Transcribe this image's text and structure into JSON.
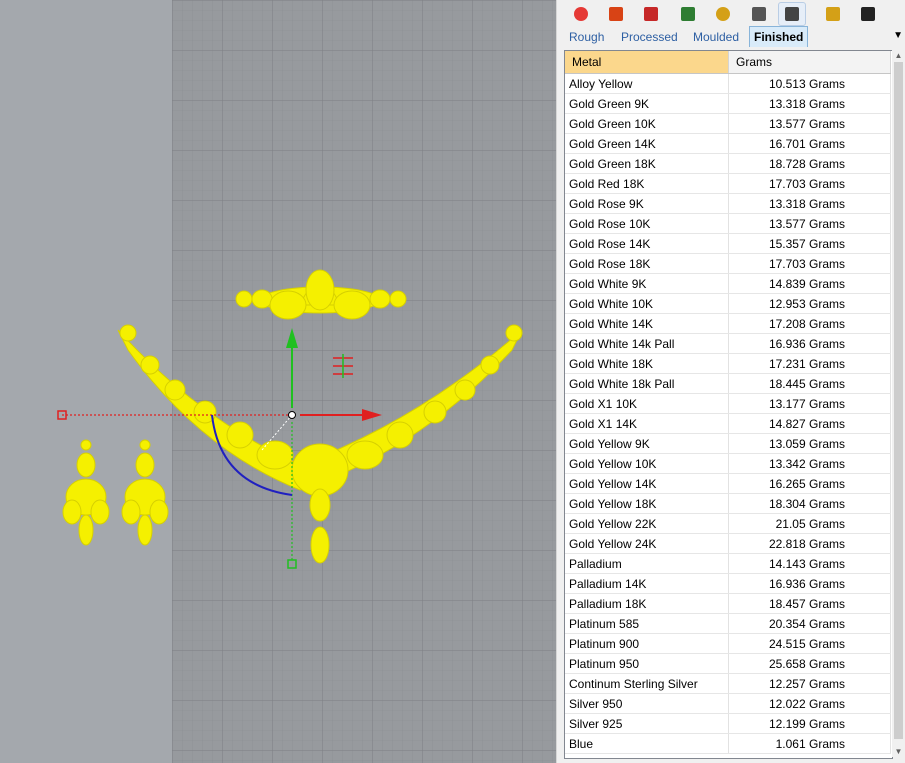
{
  "toolbar": {
    "icons": [
      {
        "name": "color-wheel-icon",
        "color": "#e53935",
        "active": false
      },
      {
        "name": "paint-bucket-icon",
        "color": "#d84315",
        "active": false
      },
      {
        "name": "brush-icon",
        "color": "#c62828",
        "active": false
      },
      {
        "name": "rg-logo-icon",
        "color": "#2e7d32",
        "active": false
      },
      {
        "name": "gold-sphere-icon",
        "color": "#d4a017",
        "active": false
      },
      {
        "name": "stopwatch-icon",
        "color": "#555555",
        "active": false
      },
      {
        "name": "weight-scale-icon",
        "color": "#444444",
        "active": true
      },
      {
        "name": "gold-bars-icon",
        "color": "#d4a017",
        "active": false
      },
      {
        "name": "monitor-icon",
        "color": "#222222",
        "active": false
      }
    ]
  },
  "tabs": [
    {
      "label": "Rough",
      "active": false
    },
    {
      "label": "Processed",
      "active": false
    },
    {
      "label": "Moulded",
      "active": false
    },
    {
      "label": "Finished",
      "active": true
    }
  ],
  "table": {
    "headers": {
      "metal": "Metal",
      "grams": "Grams"
    },
    "rows": [
      {
        "metal": "Alloy Yellow",
        "grams": "10.513 Grams"
      },
      {
        "metal": "Gold Green 9K",
        "grams": "13.318 Grams"
      },
      {
        "metal": "Gold Green 10K",
        "grams": "13.577 Grams"
      },
      {
        "metal": "Gold Green 14K",
        "grams": "16.701 Grams"
      },
      {
        "metal": "Gold Green 18K",
        "grams": "18.728 Grams"
      },
      {
        "metal": "Gold Red 18K",
        "grams": "17.703 Grams"
      },
      {
        "metal": "Gold Rose 9K",
        "grams": "13.318 Grams"
      },
      {
        "metal": "Gold Rose 10K",
        "grams": "13.577 Grams"
      },
      {
        "metal": "Gold Rose 14K",
        "grams": "15.357 Grams"
      },
      {
        "metal": "Gold Rose 18K",
        "grams": "17.703 Grams"
      },
      {
        "metal": "Gold White 9K",
        "grams": "14.839 Grams"
      },
      {
        "metal": "Gold White 10K",
        "grams": "12.953 Grams"
      },
      {
        "metal": "Gold White 14K",
        "grams": "17.208 Grams"
      },
      {
        "metal": "Gold White 14k Pall",
        "grams": "16.936 Grams"
      },
      {
        "metal": "Gold White 18K",
        "grams": "17.231 Grams"
      },
      {
        "metal": "Gold White 18k Pall",
        "grams": "18.445 Grams"
      },
      {
        "metal": "Gold X1 10K",
        "grams": "13.177 Grams"
      },
      {
        "metal": "Gold X1 14K",
        "grams": "14.827 Grams"
      },
      {
        "metal": "Gold Yellow 9K",
        "grams": "13.059 Grams"
      },
      {
        "metal": "Gold Yellow 10K",
        "grams": "13.342 Grams"
      },
      {
        "metal": "Gold Yellow 14K",
        "grams": "16.265 Grams"
      },
      {
        "metal": "Gold Yellow 18K",
        "grams": "18.304 Grams"
      },
      {
        "metal": "Gold Yellow 22K",
        "grams": "21.05 Grams"
      },
      {
        "metal": "Gold Yellow 24K",
        "grams": "22.818 Grams"
      },
      {
        "metal": "Palladium",
        "grams": "14.143 Grams"
      },
      {
        "metal": "Palladium 14K",
        "grams": "16.936 Grams"
      },
      {
        "metal": "Palladium 18K",
        "grams": "18.457 Grams"
      },
      {
        "metal": "Platinum 585",
        "grams": "20.354 Grams"
      },
      {
        "metal": "Platinum 900",
        "grams": "24.515 Grams"
      },
      {
        "metal": "Platinum 950",
        "grams": "25.658 Grams"
      },
      {
        "metal": "Continum Sterling Silver",
        "grams": "12.257 Grams"
      },
      {
        "metal": "Silver 950",
        "grams": "12.022 Grams"
      },
      {
        "metal": "Silver 925",
        "grams": "12.199 Grams"
      },
      {
        "metal": "Blue",
        "grams": "1.061 Grams"
      }
    ]
  },
  "colors": {
    "jewelry": "#f5f000",
    "gizmo_x": "#e02020",
    "gizmo_y": "#20c020",
    "gizmo_rotate": "#2020c0",
    "viewport_bg": "#a4a8ad",
    "grid_bg": "#979a9e",
    "header_selected": "#fbd78c"
  }
}
